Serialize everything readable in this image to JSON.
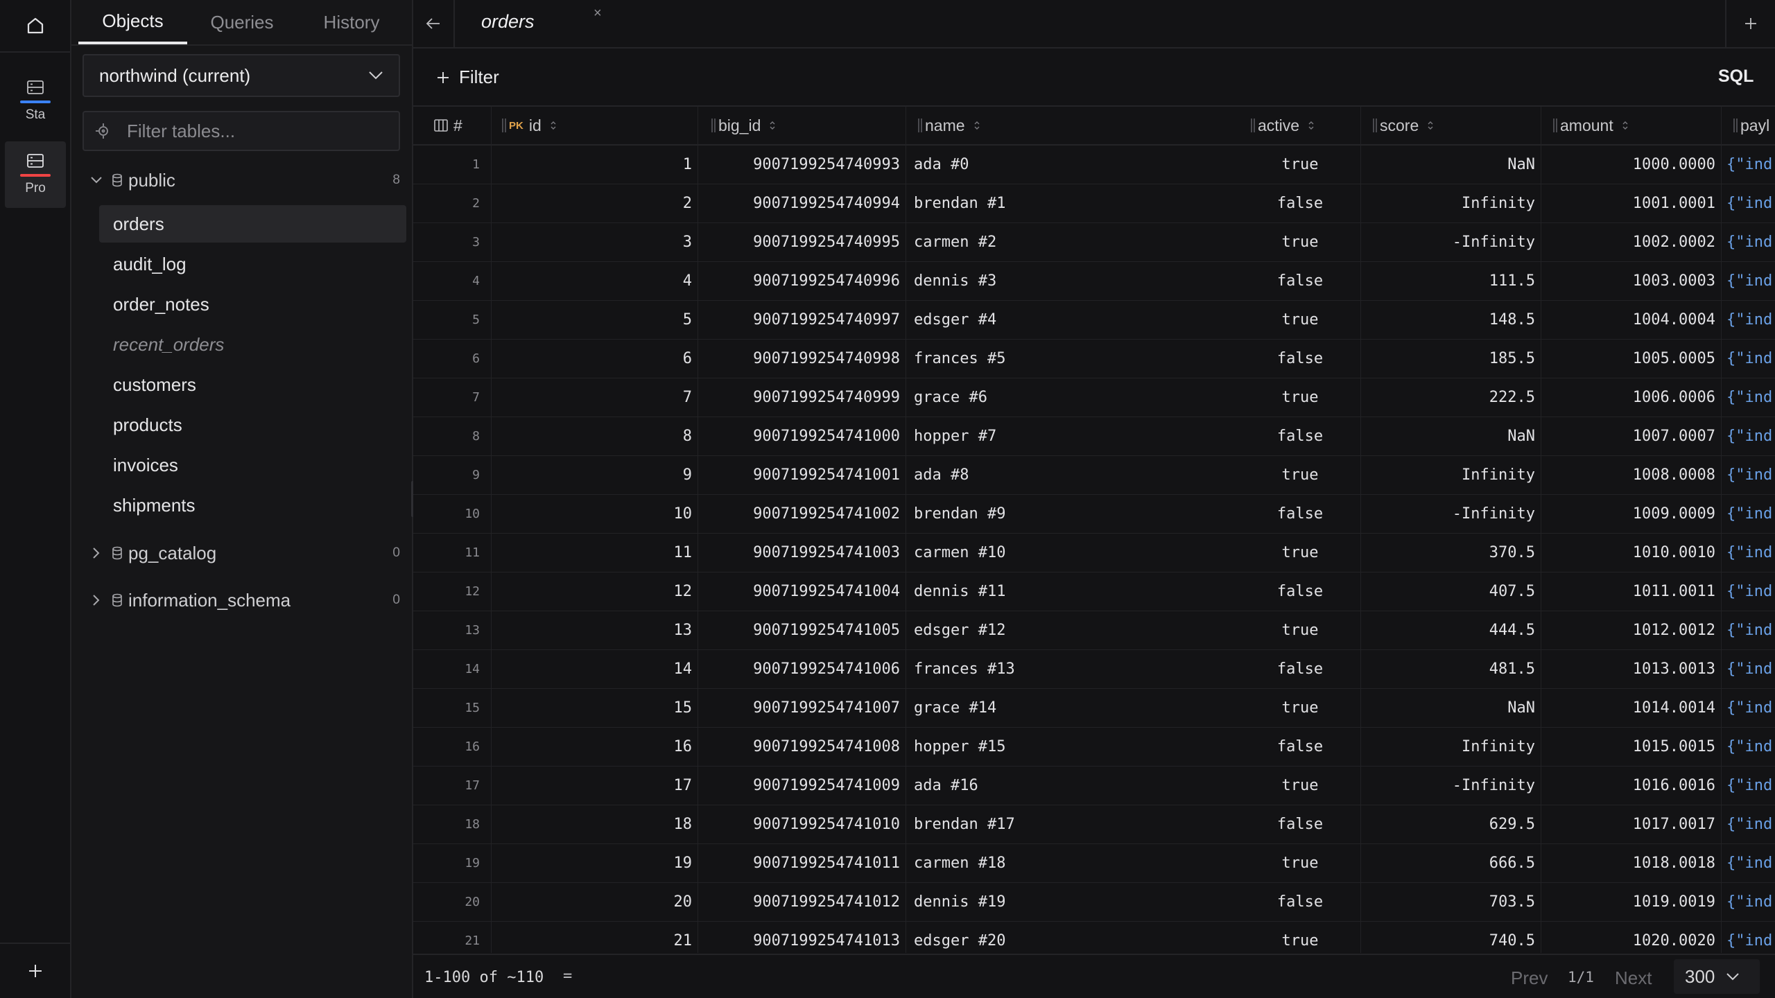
{
  "rail": {
    "connections": [
      {
        "label": "Sta",
        "accent": "#3b82f6"
      },
      {
        "label": "Pro",
        "accent": "#ef4444"
      }
    ]
  },
  "sidebar": {
    "tabs": [
      "Objects",
      "Queries",
      "History"
    ],
    "active_tab": "Objects",
    "database": "northwind (current)",
    "filter_placeholder": "Filter tables...",
    "schemas": [
      {
        "name": "public",
        "count": "8",
        "expanded": true,
        "tables": [
          {
            "name": "orders",
            "active": true
          },
          {
            "name": "audit_log"
          },
          {
            "name": "order_notes"
          },
          {
            "name": "recent_orders",
            "view": true
          },
          {
            "name": "customers"
          },
          {
            "name": "products"
          },
          {
            "name": "invoices"
          },
          {
            "name": "shipments"
          }
        ]
      },
      {
        "name": "pg_catalog",
        "count": "0",
        "expanded": false
      },
      {
        "name": "information_schema",
        "count": "0",
        "expanded": false
      }
    ]
  },
  "main": {
    "tab_title": "orders",
    "tab_close": "×",
    "filter_label": "Filter",
    "sql_label": "SQL",
    "columns": {
      "rownum": "#",
      "pk_badge": "PK",
      "id": "id",
      "big_id": "big_id",
      "name": "name",
      "active": "active",
      "score": "score",
      "amount": "amount",
      "payload": "payl"
    },
    "rows": [
      {
        "n": "1",
        "id": "1",
        "big_id": "9007199254740993",
        "name": "ada #0",
        "active": "true",
        "score": "NaN",
        "amount": "1000.0000",
        "payload": "{\"ind"
      },
      {
        "n": "2",
        "id": "2",
        "big_id": "9007199254740994",
        "name": "brendan #1",
        "active": "false",
        "score": "Infinity",
        "amount": "1001.0001",
        "payload": "{\"ind"
      },
      {
        "n": "3",
        "id": "3",
        "big_id": "9007199254740995",
        "name": "carmen #2",
        "active": "true",
        "score": "-Infinity",
        "amount": "1002.0002",
        "payload": "{\"ind"
      },
      {
        "n": "4",
        "id": "4",
        "big_id": "9007199254740996",
        "name": "dennis #3",
        "active": "false",
        "score": "111.5",
        "amount": "1003.0003",
        "payload": "{\"ind"
      },
      {
        "n": "5",
        "id": "5",
        "big_id": "9007199254740997",
        "name": "edsger #4",
        "active": "true",
        "score": "148.5",
        "amount": "1004.0004",
        "payload": "{\"ind"
      },
      {
        "n": "6",
        "id": "6",
        "big_id": "9007199254740998",
        "name": "frances #5",
        "active": "false",
        "score": "185.5",
        "amount": "1005.0005",
        "payload": "{\"ind"
      },
      {
        "n": "7",
        "id": "7",
        "big_id": "9007199254740999",
        "name": "grace #6",
        "active": "true",
        "score": "222.5",
        "amount": "1006.0006",
        "payload": "{\"ind"
      },
      {
        "n": "8",
        "id": "8",
        "big_id": "9007199254741000",
        "name": "hopper #7",
        "active": "false",
        "score": "NaN",
        "amount": "1007.0007",
        "payload": "{\"ind"
      },
      {
        "n": "9",
        "id": "9",
        "big_id": "9007199254741001",
        "name": "ada #8",
        "active": "true",
        "score": "Infinity",
        "amount": "1008.0008",
        "payload": "{\"ind"
      },
      {
        "n": "10",
        "id": "10",
        "big_id": "9007199254741002",
        "name": "brendan #9",
        "active": "false",
        "score": "-Infinity",
        "amount": "1009.0009",
        "payload": "{\"ind"
      },
      {
        "n": "11",
        "id": "11",
        "big_id": "9007199254741003",
        "name": "carmen #10",
        "active": "true",
        "score": "370.5",
        "amount": "1010.0010",
        "payload": "{\"ind"
      },
      {
        "n": "12",
        "id": "12",
        "big_id": "9007199254741004",
        "name": "dennis #11",
        "active": "false",
        "score": "407.5",
        "amount": "1011.0011",
        "payload": "{\"ind"
      },
      {
        "n": "13",
        "id": "13",
        "big_id": "9007199254741005",
        "name": "edsger #12",
        "active": "true",
        "score": "444.5",
        "amount": "1012.0012",
        "payload": "{\"ind"
      },
      {
        "n": "14",
        "id": "14",
        "big_id": "9007199254741006",
        "name": "frances #13",
        "active": "false",
        "score": "481.5",
        "amount": "1013.0013",
        "payload": "{\"ind"
      },
      {
        "n": "15",
        "id": "15",
        "big_id": "9007199254741007",
        "name": "grace #14",
        "active": "true",
        "score": "NaN",
        "amount": "1014.0014",
        "payload": "{\"ind"
      },
      {
        "n": "16",
        "id": "16",
        "big_id": "9007199254741008",
        "name": "hopper #15",
        "active": "false",
        "score": "Infinity",
        "amount": "1015.0015",
        "payload": "{\"ind"
      },
      {
        "n": "17",
        "id": "17",
        "big_id": "9007199254741009",
        "name": "ada #16",
        "active": "true",
        "score": "-Infinity",
        "amount": "1016.0016",
        "payload": "{\"ind"
      },
      {
        "n": "18",
        "id": "18",
        "big_id": "9007199254741010",
        "name": "brendan #17",
        "active": "false",
        "score": "629.5",
        "amount": "1017.0017",
        "payload": "{\"ind"
      },
      {
        "n": "19",
        "id": "19",
        "big_id": "9007199254741011",
        "name": "carmen #18",
        "active": "true",
        "score": "666.5",
        "amount": "1018.0018",
        "payload": "{\"ind"
      },
      {
        "n": "20",
        "id": "20",
        "big_id": "9007199254741012",
        "name": "dennis #19",
        "active": "false",
        "score": "703.5",
        "amount": "1019.0019",
        "payload": "{\"ind"
      },
      {
        "n": "21",
        "id": "21",
        "big_id": "9007199254741013",
        "name": "edsger #20",
        "active": "true",
        "score": "740.5",
        "amount": "1020.0020",
        "payload": "{\"ind"
      }
    ],
    "footer": {
      "range": "1-100 of ~110",
      "density_icon": "=",
      "prev": "Prev",
      "page": "1/1",
      "next": "Next",
      "page_size": "300"
    }
  }
}
